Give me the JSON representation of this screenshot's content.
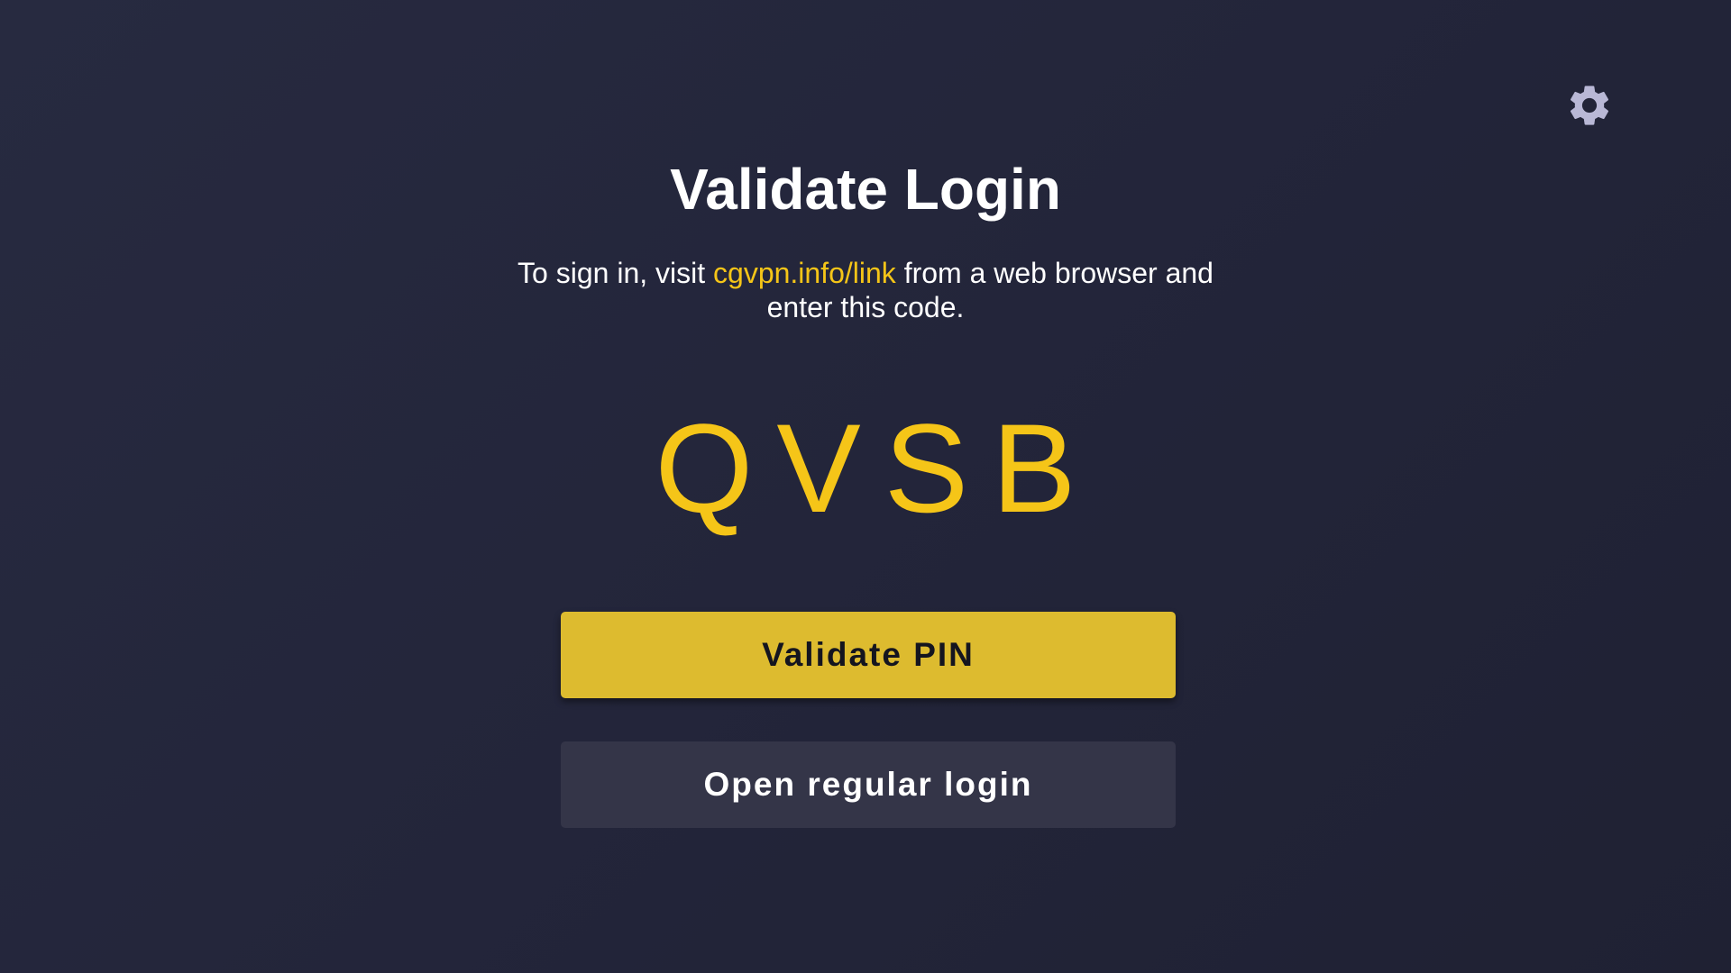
{
  "header": {
    "title": "Validate Login"
  },
  "instructions": {
    "prefix": "To sign in, visit ",
    "link": "cgvpn.info/link",
    "suffix": " from a web browser and enter this code."
  },
  "pin": {
    "code": "QVSB"
  },
  "actions": {
    "validate_label": "Validate PIN",
    "regular_login_label": "Open regular login"
  },
  "icons": {
    "settings": "gear-icon"
  },
  "colors": {
    "accent": "#f5c518",
    "primary_button": "#ddbb2f",
    "secondary_button": "#343548",
    "background": "#23253a"
  }
}
